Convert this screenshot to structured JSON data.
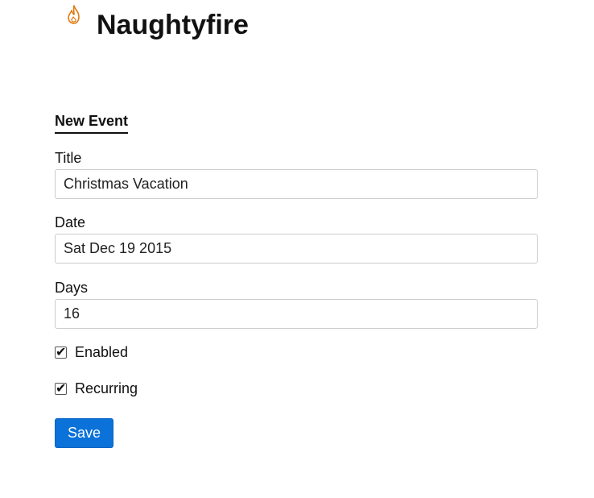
{
  "header": {
    "logo_icon": "flame-icon",
    "app_title": "Naughtyfire",
    "accent_color": "#e07a10"
  },
  "form": {
    "heading": "New Event",
    "fields": {
      "title": {
        "label": "Title",
        "value": "Christmas Vacation"
      },
      "date": {
        "label": "Date",
        "value": "Sat Dec 19 2015"
      },
      "days": {
        "label": "Days",
        "value": "16"
      }
    },
    "checkboxes": {
      "enabled": {
        "label": "Enabled",
        "checked": true,
        "mark": "✔"
      },
      "recurring": {
        "label": "Recurring",
        "checked": true,
        "mark": "✔"
      }
    },
    "save_label": "Save",
    "button_color": "#0a72d9"
  }
}
